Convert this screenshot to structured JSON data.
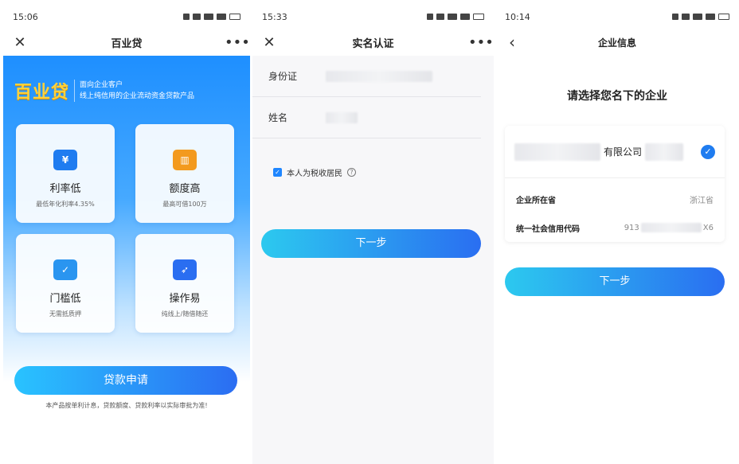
{
  "screen1": {
    "time": "15:06",
    "title": "百业贷",
    "brand": "百业贷",
    "tagline1": "面向企业客户",
    "tagline2": "线上纯信用的企业流动资金贷款产品",
    "cards": [
      {
        "title": "利率低",
        "sub": "最低年化利率4.35%",
        "icon": "yen-icon",
        "color": "#1f7cf0"
      },
      {
        "title": "额度高",
        "sub": "最高可借100万",
        "icon": "chart-icon",
        "color": "#f39a1e"
      },
      {
        "title": "门槛低",
        "sub": "无需抵质押",
        "icon": "folder-icon",
        "color": "#2a95f0"
      },
      {
        "title": "操作易",
        "sub": "纯线上/随借随还",
        "icon": "rocket-icon",
        "color": "#2a6ef1"
      }
    ],
    "apply_label": "贷款申请",
    "footnote": "本产品按单利计息，贷款额度、贷款利率以实际审批为准!"
  },
  "screen2": {
    "time": "15:33",
    "title": "实名认证",
    "id_label": "身份证",
    "name_label": "姓名",
    "tax_label": "本人为税收居民",
    "next_label": "下一步"
  },
  "screen3": {
    "time": "10:14",
    "title": "企业信息",
    "heading": "请选择您名下的企业",
    "company_name": "有限公司",
    "province_label": "企业所在省",
    "province_value": "浙江省",
    "credit_code_label": "统一社会信用代码",
    "credit_code_prefix": "913",
    "credit_code_suffix": "X6",
    "next_label": "下一步"
  },
  "icons": {
    "close": "close-icon",
    "more": "more-icon",
    "back": "back-icon"
  }
}
